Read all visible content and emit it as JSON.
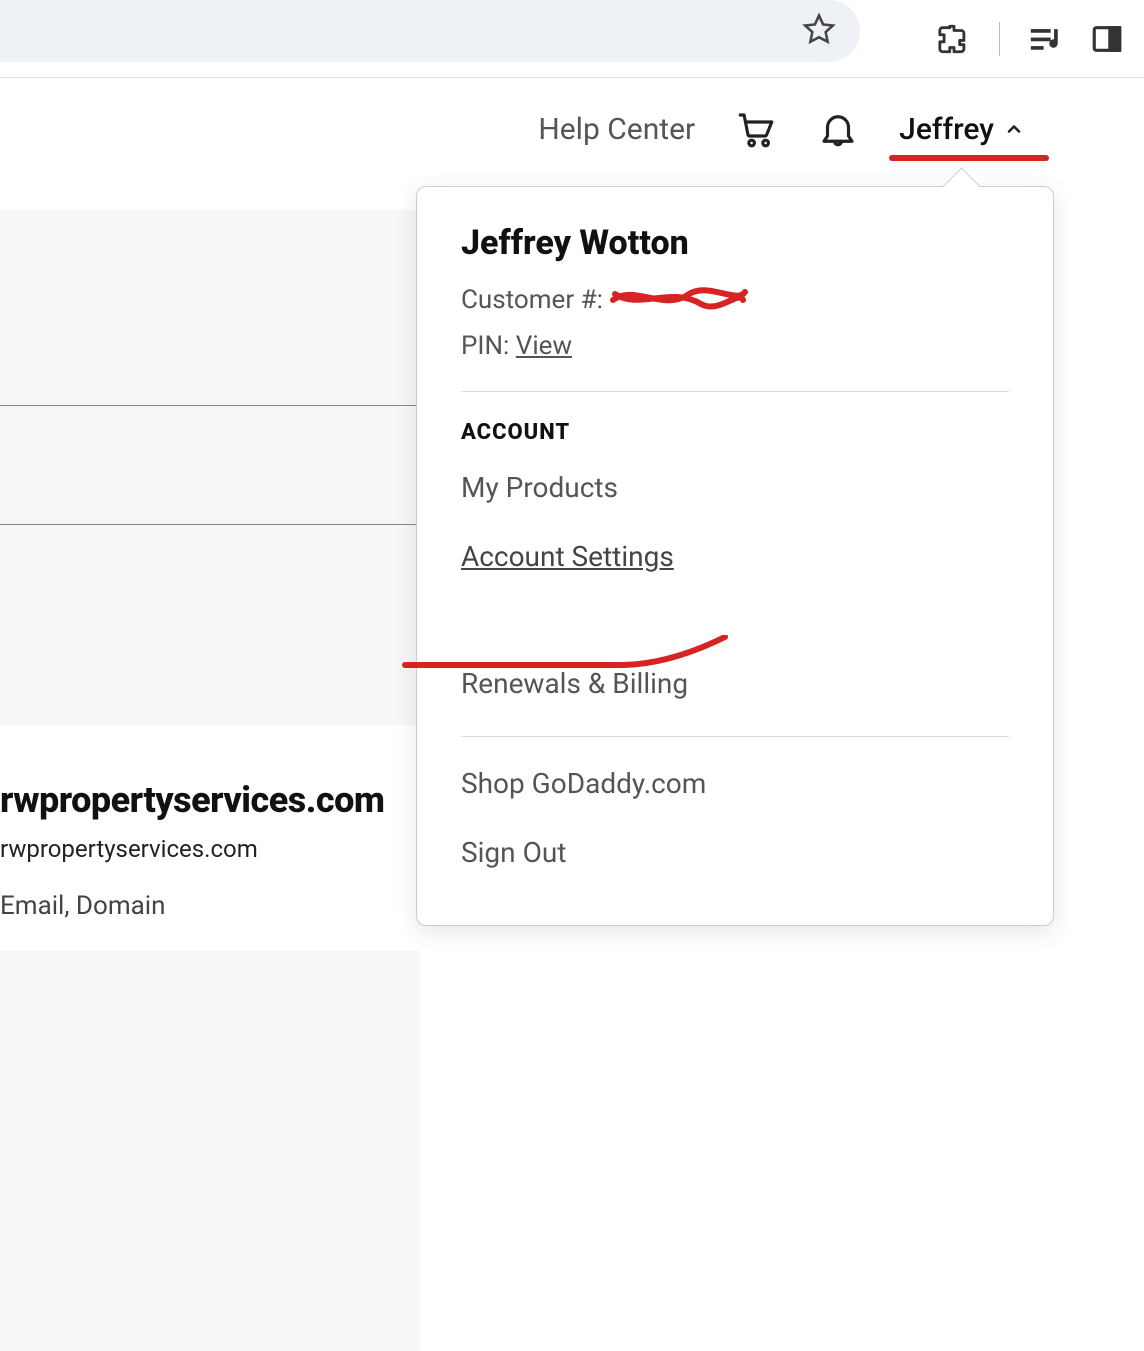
{
  "header": {
    "help_label": "Help Center",
    "user_first_name": "Jeffrey"
  },
  "dropdown": {
    "full_name": "Jeffrey Wotton",
    "customer_number_label": "Customer #:",
    "customer_number_value": "",
    "pin_label": "PIN:",
    "pin_link": "View",
    "account_section_label": "ACCOUNT",
    "items": [
      {
        "label": "My Products"
      },
      {
        "label": "Account Settings"
      },
      {
        "label": "Renewals & Billing"
      }
    ],
    "footer_items": [
      {
        "label": "Shop GoDaddy.com"
      },
      {
        "label": "Sign Out"
      }
    ]
  },
  "background": {
    "domain_title": "rwpropertyservices.com",
    "domain_sub": "rwpropertyservices.com",
    "domain_tags": "Email, Domain"
  }
}
